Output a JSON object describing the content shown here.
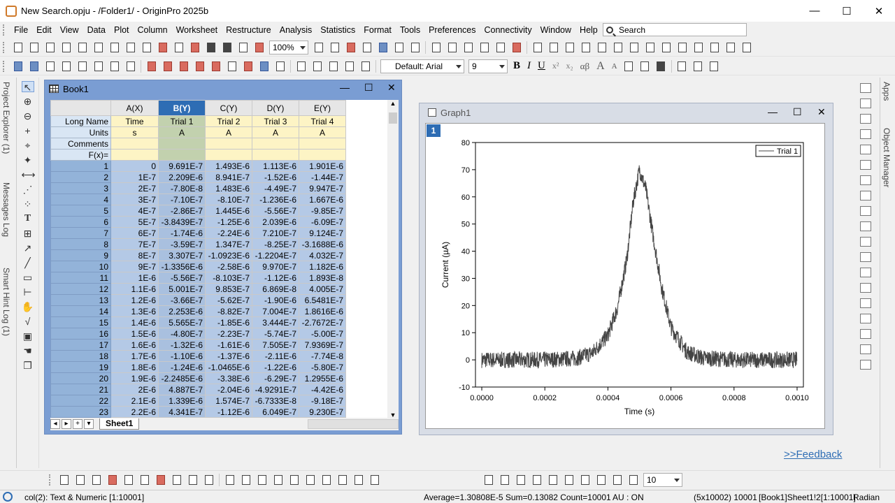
{
  "window": {
    "title": "New Search.opju - /Folder1/ - OriginPro 2025b",
    "minimize": "—",
    "maximize": "☐",
    "close": "✕"
  },
  "menu": [
    "File",
    "Edit",
    "View",
    "Data",
    "Plot",
    "Column",
    "Worksheet",
    "Restructure",
    "Analysis",
    "Statistics",
    "Format",
    "Tools",
    "Preferences",
    "Connectivity",
    "Window",
    "Help"
  ],
  "search": {
    "placeholder": "Search"
  },
  "toolbar": {
    "zoom": "100%",
    "font": "Default: Arial",
    "font_size": "9",
    "bold": "B",
    "italic": "I",
    "underline": "U",
    "superscript": "x²",
    "subscript": "x₂",
    "greek": "αβ",
    "increase_font": "A",
    "decrease_font": "A"
  },
  "side_tabs": {
    "project_explorer": "Project Explorer (1)",
    "messages_log": "Messages Log",
    "smart_hint_log": "Smart Hint Log (1)",
    "apps": "Apps",
    "object_manager": "Object Manager"
  },
  "book": {
    "title": "Book1",
    "columns": [
      {
        "name": "A(X)",
        "long_name": "Time",
        "units": "s",
        "selected": false
      },
      {
        "name": "B(Y)",
        "long_name": "Trial 1",
        "units": "A",
        "selected": true
      },
      {
        "name": "C(Y)",
        "long_name": "Trial 2",
        "units": "A",
        "selected": false
      },
      {
        "name": "D(Y)",
        "long_name": "Trial 3",
        "units": "A",
        "selected": false
      },
      {
        "name": "E(Y)",
        "long_name": "Trial 4",
        "units": "A",
        "selected": false
      }
    ],
    "row_labels": {
      "long_name": "Long Name",
      "units": "Units",
      "comments": "Comments",
      "fx": "F(x)="
    },
    "rows": [
      [
        "1",
        "0",
        "9.691E-7",
        "1.493E-6",
        "1.113E-6",
        "1.901E-6"
      ],
      [
        "2",
        "1E-7",
        "2.209E-6",
        "8.941E-7",
        "-1.52E-6",
        "-1.44E-7"
      ],
      [
        "3",
        "2E-7",
        "-7.80E-8",
        "1.483E-6",
        "-4.49E-7",
        "9.947E-7"
      ],
      [
        "4",
        "3E-7",
        "-7.10E-7",
        "-8.10E-7",
        "-1.236E-6",
        "1.667E-6"
      ],
      [
        "5",
        "4E-7",
        "-2.86E-7",
        "1.445E-6",
        "-5.56E-7",
        "-9.85E-7"
      ],
      [
        "6",
        "5E-7",
        "-3.8439E-7",
        "-1.25E-6",
        "2.039E-6",
        "-6.09E-7"
      ],
      [
        "7",
        "6E-7",
        "-1.74E-6",
        "-2.24E-6",
        "7.210E-7",
        "9.124E-7"
      ],
      [
        "8",
        "7E-7",
        "-3.59E-7",
        "1.347E-7",
        "-8.25E-7",
        "-3.1688E-6"
      ],
      [
        "9",
        "8E-7",
        "3.307E-7",
        "-1.0923E-6",
        "-1.2204E-7",
        "4.032E-7"
      ],
      [
        "10",
        "9E-7",
        "-1.3356E-6",
        "-2.58E-6",
        "9.970E-7",
        "1.182E-6"
      ],
      [
        "11",
        "1E-6",
        "-5.56E-7",
        "-8.103E-7",
        "-1.12E-6",
        "1.893E-8"
      ],
      [
        "12",
        "1.1E-6",
        "5.001E-7",
        "9.853E-7",
        "6.869E-8",
        "4.005E-7"
      ],
      [
        "13",
        "1.2E-6",
        "-3.66E-7",
        "-5.62E-7",
        "-1.90E-6",
        "6.5481E-7"
      ],
      [
        "14",
        "1.3E-6",
        "2.253E-6",
        "-8.82E-7",
        "7.004E-7",
        "1.8616E-6"
      ],
      [
        "15",
        "1.4E-6",
        "5.565E-7",
        "-1.85E-6",
        "3.444E-7",
        "-2.7672E-7"
      ],
      [
        "16",
        "1.5E-6",
        "-4.80E-7",
        "-2.23E-7",
        "-5.74E-7",
        "-5.00E-7"
      ],
      [
        "17",
        "1.6E-6",
        "-1.32E-6",
        "-1.61E-6",
        "7.505E-7",
        "7.9369E-7"
      ],
      [
        "18",
        "1.7E-6",
        "-1.10E-6",
        "-1.37E-6",
        "-2.11E-6",
        "-7.74E-8"
      ],
      [
        "19",
        "1.8E-6",
        "-1.24E-6",
        "-1.0465E-6",
        "-1.22E-6",
        "-5.80E-7"
      ],
      [
        "20",
        "1.9E-6",
        "-2.2485E-6",
        "-3.38E-6",
        "-6.29E-7",
        "1.2955E-6"
      ],
      [
        "21",
        "2E-6",
        "4.887E-7",
        "-2.04E-6",
        "-4.9291E-7",
        "-4.42E-6"
      ],
      [
        "22",
        "2.1E-6",
        "1.339E-6",
        "1.574E-7",
        "-6.7333E-8",
        "-9.18E-7"
      ],
      [
        "23",
        "2.2E-6",
        "4.341E-7",
        "-1.12E-6",
        "6.049E-7",
        "9.230E-7"
      ]
    ],
    "sheet_tab": "Sheet1"
  },
  "graph": {
    "title": "Graph1",
    "layer_label": "1"
  },
  "chart_data": {
    "type": "line",
    "title": "",
    "xlabel": "Time (s)",
    "ylabel": "Current (µA)",
    "xlim": [
      -2e-05,
      0.00102
    ],
    "ylim": [
      -10,
      80
    ],
    "x_ticks": [
      "0.0000",
      "0.0002",
      "0.0004",
      "0.0006",
      "0.0008",
      "0.0010"
    ],
    "y_ticks": [
      "-10",
      "0",
      "10",
      "20",
      "30",
      "40",
      "50",
      "60",
      "70",
      "80"
    ],
    "series": [
      {
        "name": "Trial 1",
        "color": "#444444",
        "peak_x": 0.0005,
        "peak_y": 70,
        "x": [
          0,
          0.0001,
          0.0002,
          0.0003,
          0.00035,
          0.0004,
          0.00043,
          0.00046,
          0.00048,
          0.0005,
          0.00052,
          0.00054,
          0.00057,
          0.0006,
          0.00065,
          0.0007,
          0.0008,
          0.0009,
          0.001
        ],
        "values": [
          0,
          0,
          0,
          0.6,
          2.5,
          9,
          19,
          37,
          58,
          70,
          63,
          48,
          27,
          12,
          3,
          0.7,
          0,
          0,
          0
        ]
      }
    ],
    "legend": "top-right",
    "grid": false
  },
  "feedback": ">>Feedback",
  "bottom_toolbar": {
    "size": "10"
  },
  "status": {
    "left": "col(2): Text & Numeric [1:10001]",
    "stats": "Average=1.30808E-5 Sum=0.13082 Count=10001",
    "au": "AU : ON",
    "dims": "(5x10002) 10001",
    "range": "[Book1]Sheet1!2[1:10001]",
    "angle": "Radian"
  }
}
